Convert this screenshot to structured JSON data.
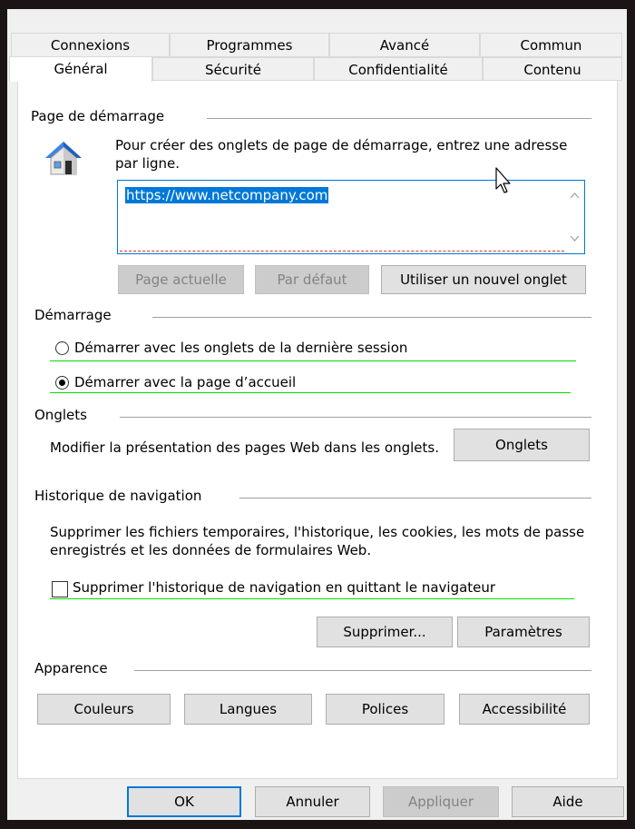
{
  "tabs_top": [
    "Connexions",
    "Programmes",
    "Avancé",
    "Commun"
  ],
  "tabs_bottom": [
    "Général",
    "Sécurité",
    "Confidentialité",
    "Contenu"
  ],
  "home": {
    "title": "Page de démarrage",
    "description": "Pour créer des onglets de page de démarrage, entrez une adresse par ligne.",
    "url": "https://www.netcompany.com",
    "btn_current": "Page actuelle",
    "btn_default": "Par défaut",
    "btn_new_tab": "Utiliser un nouvel onglet"
  },
  "startup": {
    "title": "Démarrage",
    "option_last_session": "Démarrer avec les onglets de la dernière session",
    "option_home_page": "Démarrer avec la page d’accueil",
    "selected": "home_page"
  },
  "tabs_group": {
    "title": "Onglets",
    "description": "Modifier la présentation des pages Web dans les onglets.",
    "button": "Onglets"
  },
  "history": {
    "title": "Historique de navigation",
    "description": "Supprimer les fichiers temporaires, l'historique, les cookies, les mots de passe enregistrés et les données de formulaires Web.",
    "checkbox_label": "Supprimer l'historique de navigation en quittant le navigateur",
    "checkbox_checked": false,
    "btn_delete": "Supprimer...",
    "btn_settings": "Paramètres"
  },
  "appearance": {
    "title": "Apparence",
    "btn_colors": "Couleurs",
    "btn_languages": "Langues",
    "btn_fonts": "Polices",
    "btn_accessibility": "Accessibilité"
  },
  "footer": {
    "ok": "OK",
    "cancel": "Annuler",
    "apply": "Appliquer",
    "help": "Aide"
  },
  "colors": {
    "accent": "#0078d7",
    "focus_underline": "#00e000"
  }
}
